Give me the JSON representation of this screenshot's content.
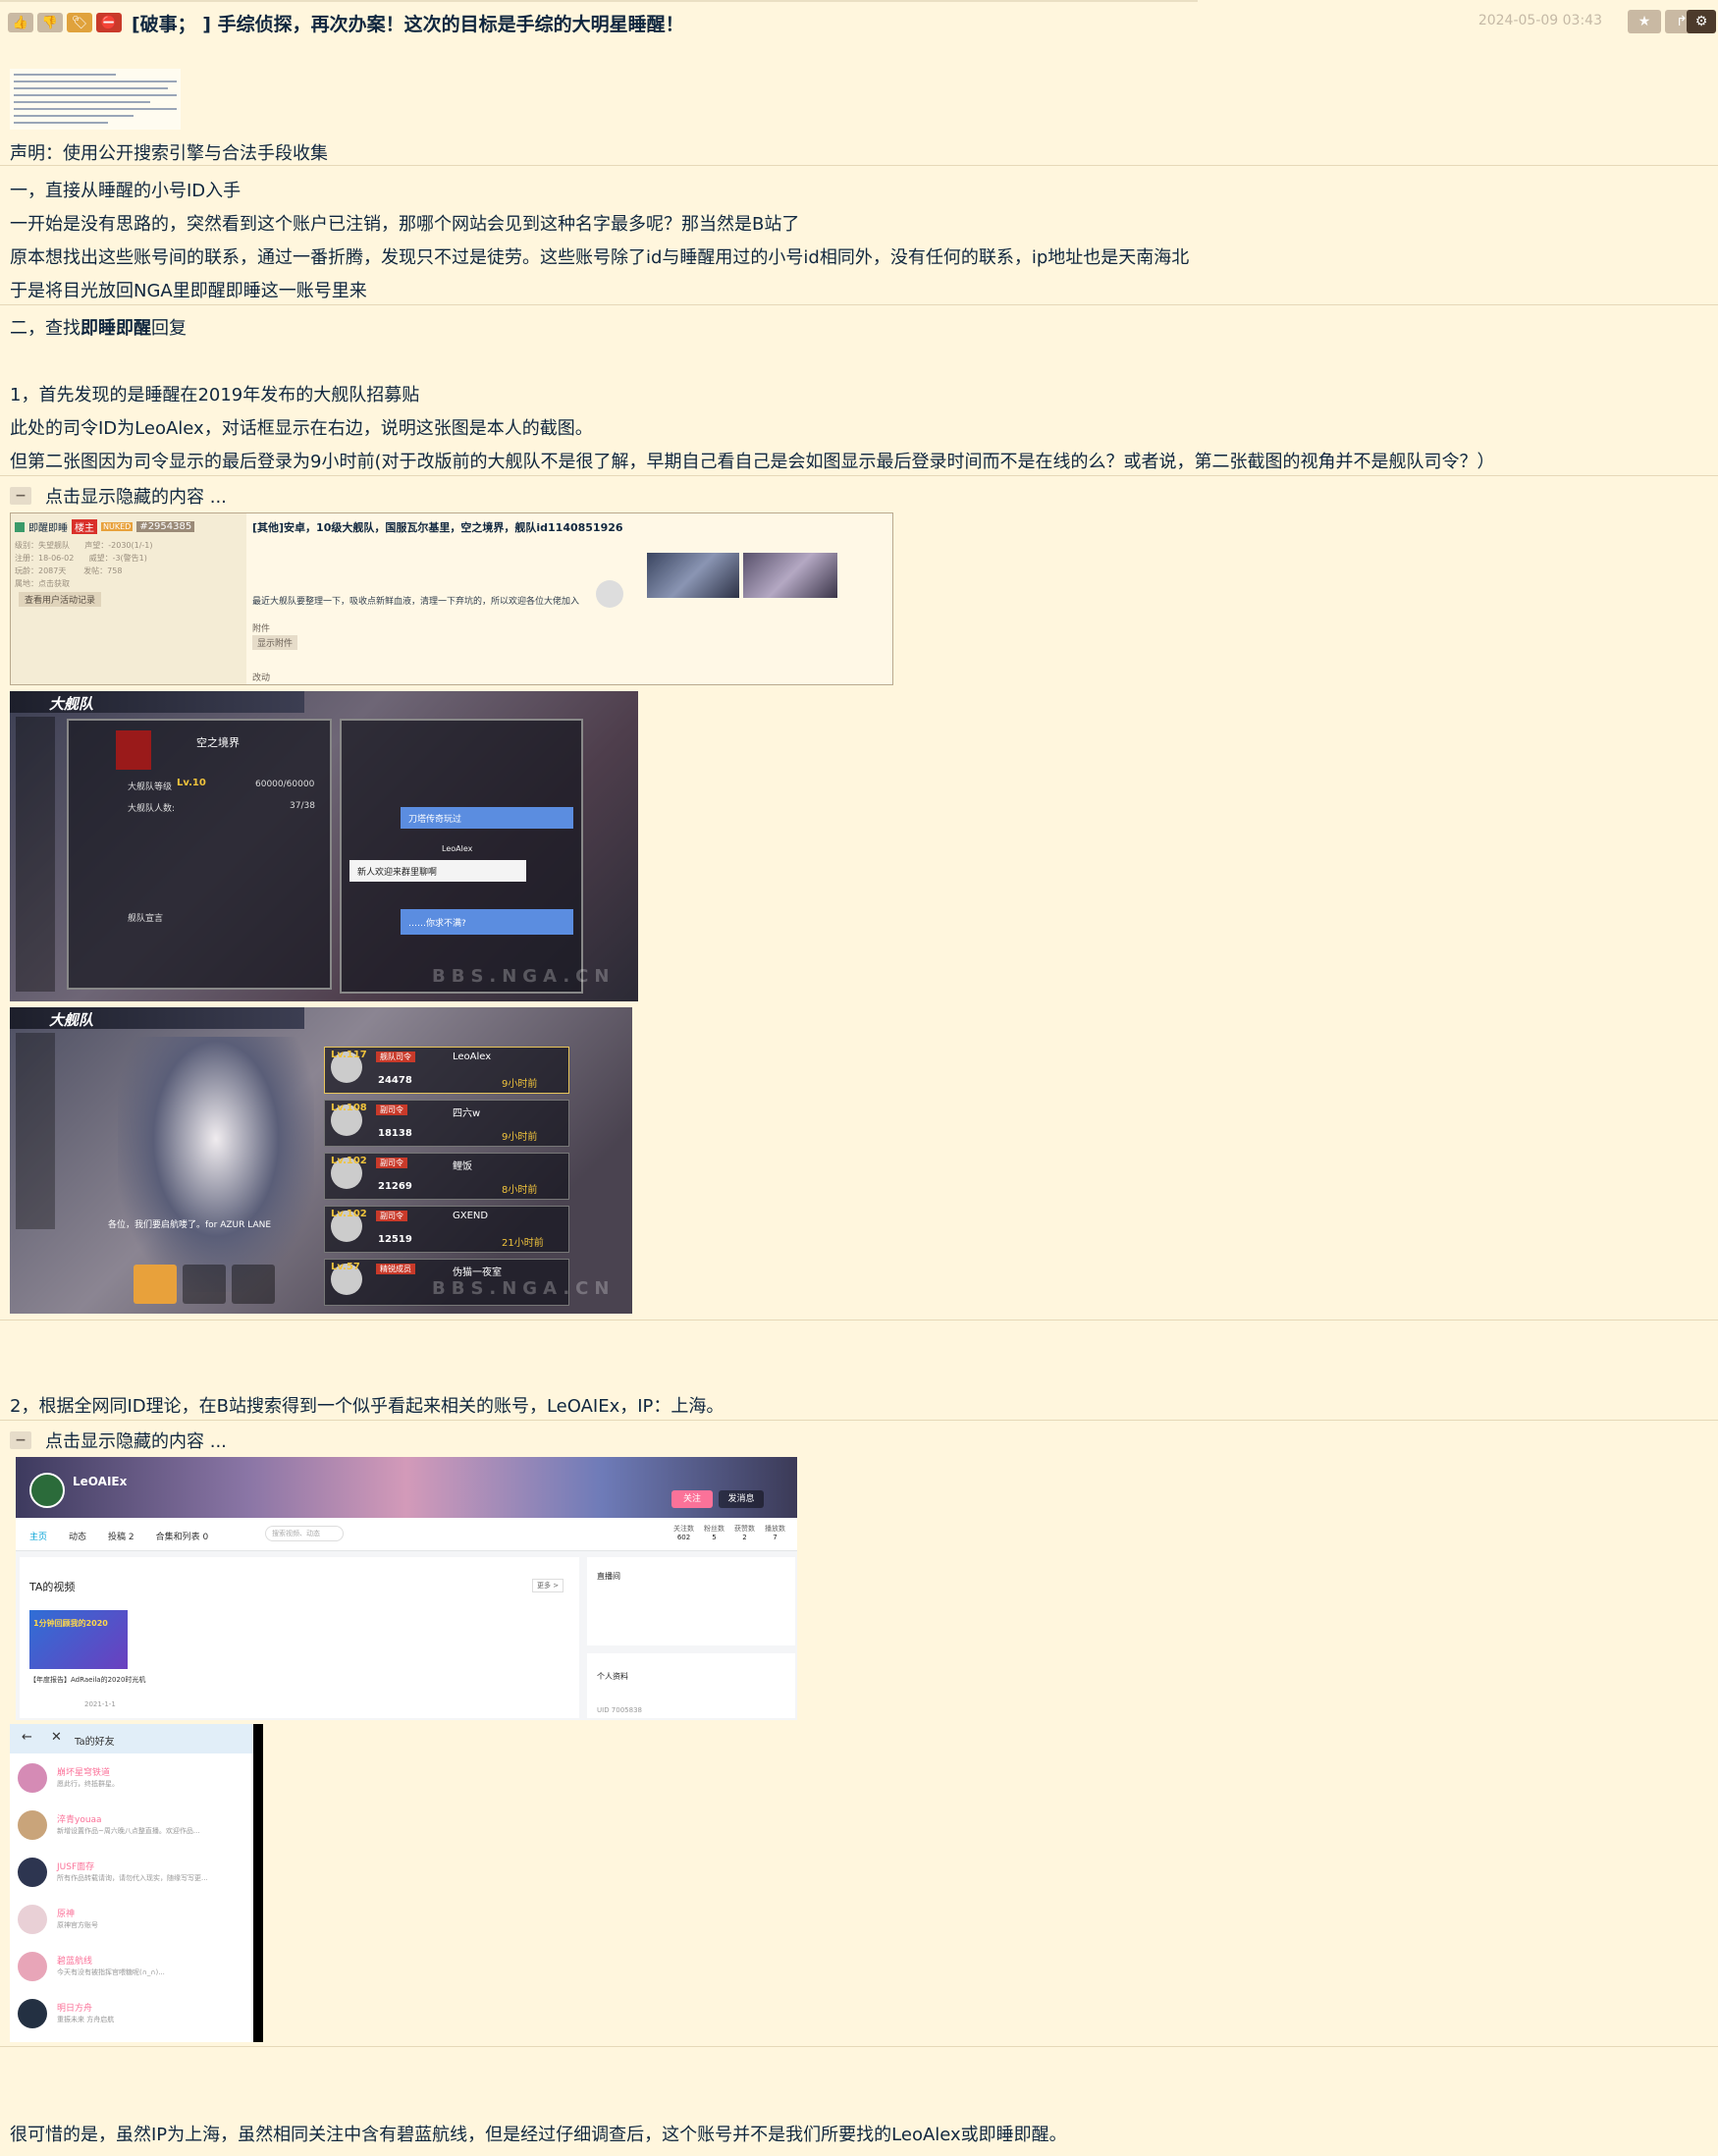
{
  "header": {
    "title": "[破事； ] 手综侦探，再次办案！这次的目标是手综的大明星睡醒！",
    "date": "2024-05-09 03:43",
    "icons": [
      "thumb-up-icon",
      "thumb-down-icon",
      "tag-icon",
      "block-icon"
    ],
    "right_icons": [
      "star-icon",
      "share-icon",
      "gear-icon"
    ]
  },
  "post": {
    "statement": "声明：使用公开搜索引擎与合法手段收集",
    "s1_title": "一，直接从睡醒的小号ID入手",
    "s1_p1": "一开始是没有思路的，突然看到这个账户已注销，那哪个网站会见到这种名字最多呢？那当然是B站了",
    "s1_p2": "原本想找出这些账号间的联系，通过一番折腾，发现只不过是徒劳。这些账号除了id与睡醒用过的小号id相同外，没有任何的联系，ip地址也是天南海北",
    "s1_p3": "于是将目光放回NGA里即醒即睡这一账号里来",
    "s2_prefix": "二，查找",
    "s2_bold": "即睡即醒",
    "s2_suffix": "回复",
    "p1": "1，首先发现的是睡醒在2019年发布的大舰队招募贴",
    "p2": "此处的司令ID为LeoAlex，对话框显示在右边，说明这张图是本人的截图。",
    "p3": "但第二张图因为司令显示的最后登录为9小时前(对于改版前的大舰队不是很了解，早期自己看自己是会如图显示最后登录时间而不是在线的么？或者说，第二张截图的视角并不是舰队司令？）",
    "collapse1": "点击显示隐藏的内容 ...",
    "p4": "2，根据全网同ID理论，在B站搜索得到一个似乎看起来相关的账号，LeOAIEx，IP：上海。",
    "collapse2": "点击显示隐藏的内容 ...",
    "p5": "很可惜的是，虽然IP为上海，虽然相同关注中含有碧蓝航线，但是经过仔细调查后，这个账号并不是我们所要找的LeoAlex或即睡即醒。"
  },
  "shot1": {
    "user": "即醒即睡",
    "badge": "楼主",
    "uid": "#2954385",
    "post_title": "[其他]安卓，10级大舰队，国服瓦尔基里，空之境界，舰队id1140851926",
    "post_body": "最近大舰队要整理一下，吸收点新鲜血液，清理一下弃坑的，所以欢迎各位大佬加入",
    "attach": "附件",
    "show_attach": "显示附件",
    "edit": "改动",
    "view_records": "查看用户活动记录"
  },
  "shot2": {
    "fleet": "大舰队",
    "fleet_name": "空之境界",
    "level_label": "大舰队等级",
    "level": "Lv.10",
    "exp": "60000/60000",
    "members_label": "大舰队人数:",
    "members": "37/38",
    "chat1": "刀塔传奇玩过",
    "chat2": "新人欢迎来群里聊啊",
    "chat3": "……你求不满?",
    "sender": "LeoAlex",
    "declaration": "舰队宣言",
    "watermark": "BBS.NGA.CN"
  },
  "shot3": {
    "fleet": "大舰队",
    "rows": [
      {
        "lv": "Lv.117",
        "role": "舰队司令",
        "name": "LeoAlex",
        "act": "24478",
        "last": "9小时前"
      },
      {
        "lv": "Lv.108",
        "role": "副司令",
        "name": "四六w",
        "act": "18138",
        "last": "9小时前"
      },
      {
        "lv": "Lv.102",
        "role": "副司令",
        "name": "鲤饭",
        "act": "21269",
        "last": "8小时前"
      },
      {
        "lv": "Lv.102",
        "role": "副司令",
        "name": "GXEND",
        "act": "12519",
        "last": "21小时前"
      },
      {
        "lv": "Lv.57",
        "role": "精锐成员",
        "name": "伪猫一夜室",
        "act": "",
        "last": ""
      }
    ],
    "caption": "各位，我们要启航喽了。for AZUR LANE",
    "watermark": "BBS.NGA.CN"
  },
  "shot4": {
    "username": "LeOAIEx",
    "tabs": [
      "主页",
      "动态",
      "投稿 2",
      "合集和列表 0"
    ],
    "search_placeholder": "搜索视频、动态",
    "stats_labels": [
      "关注数",
      "粉丝数",
      "获赞数",
      "播放数"
    ],
    "stats": [
      "602",
      "5",
      "2",
      "7"
    ],
    "videos_title": "TA的视频",
    "more": "更多 >",
    "video_caption": "【年度报告】AdRaeila的2020时光机",
    "video_date": "2021-1-1",
    "thumb_text": "1分钟回顾我的2020",
    "follow": "关注",
    "message": "发消息",
    "live": "直播间",
    "profile": "个人资料",
    "uid": "UID 7005838"
  },
  "shot5": {
    "title": "Ta的好友",
    "friends": [
      {
        "name": "崩坏星穹铁道",
        "desc": "愿此行，终抵群星。"
      },
      {
        "name": "淬青youaa",
        "desc": "新增设置作品~周六晚八点整直播。欢迎作品..."
      },
      {
        "name": "JUSF面存",
        "desc": "所有作品转载请询，请勿代入现实，随缘写写更..."
      },
      {
        "name": "原神",
        "desc": "原神官方账号"
      },
      {
        "name": "碧蓝航线",
        "desc": "今天有没有被指挥官喂糖呢(∩_∩)..."
      },
      {
        "name": "明日方舟",
        "desc": "重振未来 方舟启航"
      }
    ]
  }
}
